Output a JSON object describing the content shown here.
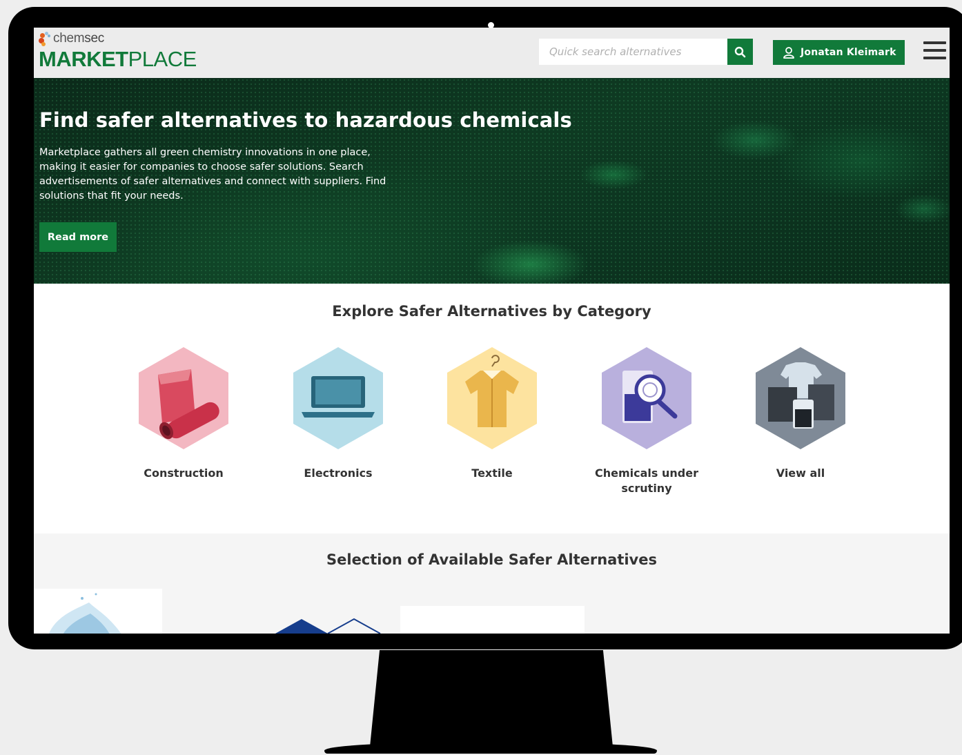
{
  "logo": {
    "brand_prefix": "chem",
    "brand_suffix": "sec",
    "product_strong": "MARKET",
    "product_light": "PLACE"
  },
  "header": {
    "search_placeholder": "Quick search alternatives",
    "user_name": "Jonatan Kleimark"
  },
  "hero": {
    "title": "Find safer alternatives to hazardous chemicals",
    "text": "Marketplace gathers all green chemistry innovations in one place, making it easier for companies to choose safer solutions. Search advertisements of safer alternatives and connect with suppliers. Find solutions that fit your needs.",
    "button": "Read more"
  },
  "categories": {
    "title": "Explore Safer Alternatives by Category",
    "items": [
      {
        "label": "Construction",
        "color": "#f3b7c1",
        "icon": "construction-icon"
      },
      {
        "label": "Electronics",
        "color": "#b5dde9",
        "icon": "laptop-icon"
      },
      {
        "label": "Textile",
        "color": "#fde39f",
        "icon": "shirt-icon"
      },
      {
        "label": "Chemicals under scrutiny",
        "color": "#b9b0dd",
        "icon": "beaker-magnifier-icon"
      },
      {
        "label": "View all",
        "color": "#7f8a97",
        "icon": "view-all-icon"
      }
    ]
  },
  "selection": {
    "title": "Selection of Available Safer Alternatives"
  },
  "colors": {
    "brand_green": "#117a3a",
    "header_bg": "#ececec"
  }
}
